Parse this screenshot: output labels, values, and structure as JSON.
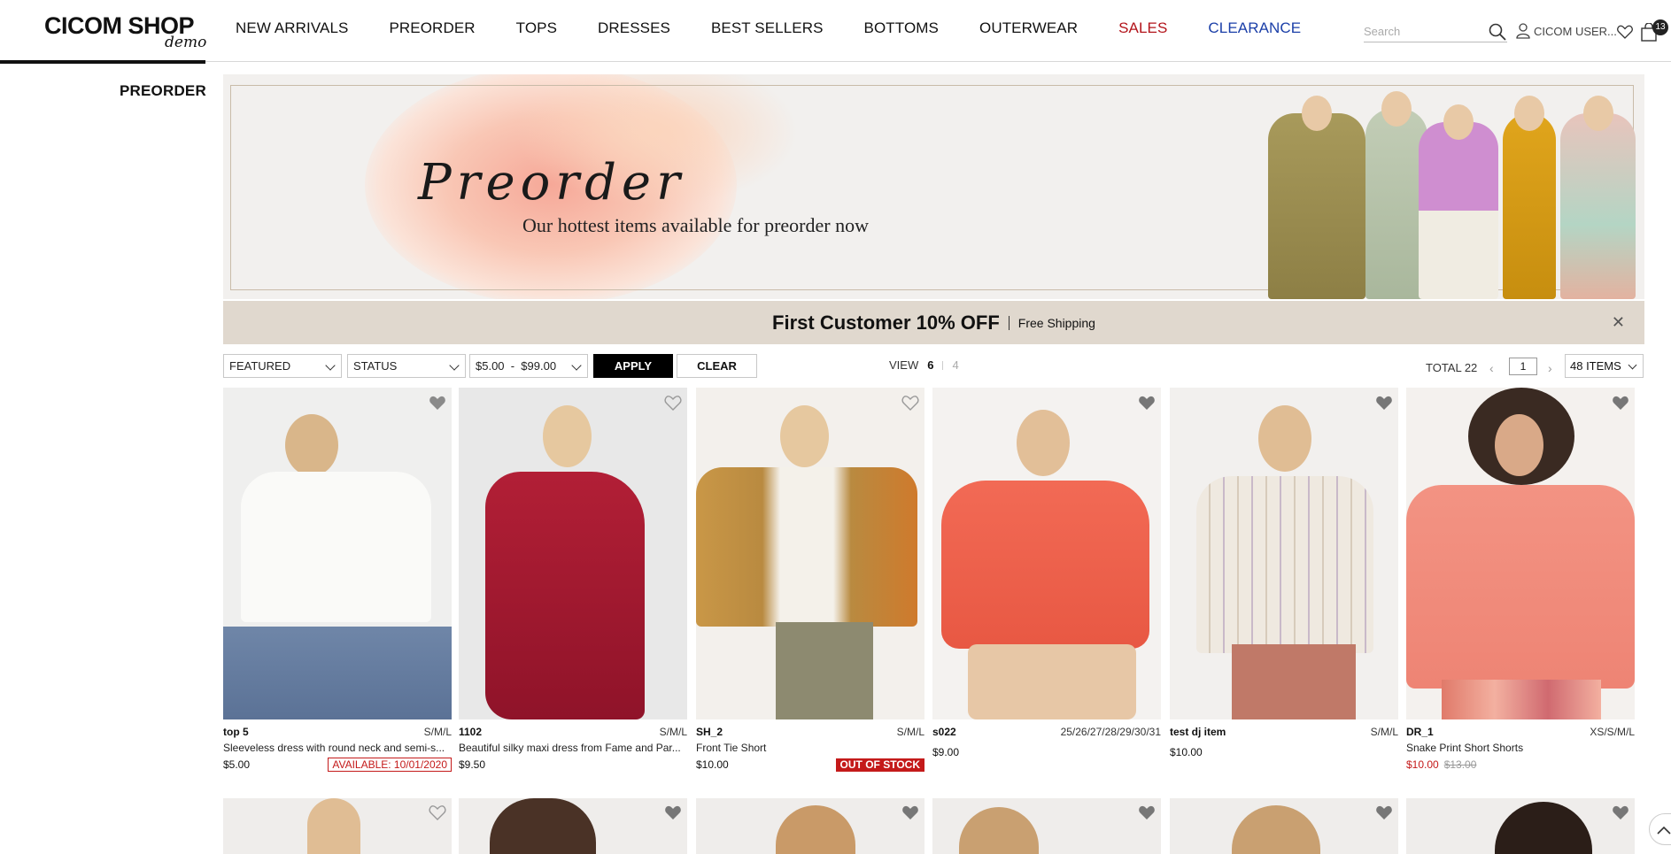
{
  "brand": {
    "main": "CICOM SHOP",
    "sub": "demo"
  },
  "nav": [
    {
      "label": "NEW ARRIVALS",
      "style": "normal"
    },
    {
      "label": "PREORDER",
      "style": "normal"
    },
    {
      "label": "TOPS",
      "style": "normal"
    },
    {
      "label": "DRESSES",
      "style": "normal"
    },
    {
      "label": "BEST SELLERS",
      "style": "normal"
    },
    {
      "label": "BOTTOMS",
      "style": "normal"
    },
    {
      "label": "OUTERWEAR",
      "style": "normal"
    },
    {
      "label": "SALES",
      "style": "sales"
    },
    {
      "label": "CLEARANCE",
      "style": "clearance"
    }
  ],
  "header": {
    "search_placeholder": "Search",
    "user_label": "CICOM USER...",
    "cart_count": "13"
  },
  "sidebar": {
    "title": "PREORDER"
  },
  "banner": {
    "title": "Preorder",
    "subtitle": "Our hottest items available for preorder now"
  },
  "promo": {
    "title": "First Customer 10% OFF",
    "subtitle": "Free Shipping",
    "close": "✕"
  },
  "filters": {
    "sort": "FEATURED",
    "status": "STATUS",
    "price": "$5.00  -  $99.00",
    "apply": "APPLY",
    "clear": "CLEAR"
  },
  "view": {
    "label": "VIEW",
    "active": "6",
    "inactive": "4"
  },
  "pagination": {
    "total": "TOTAL 22",
    "page": "1",
    "per_page": "48 ITEMS"
  },
  "colors": {
    "sale_red": "#b3141b",
    "clearance_blue": "#1b3fa8",
    "promo_bg": "#e0d8ce"
  },
  "products": [
    {
      "sku": "top 5",
      "sizes": "S/M/L",
      "desc": "Sleeveless dress with round neck and semi-s...",
      "price": "$5.00",
      "badge": "AVAILABLE: 10/01/2020",
      "badge_type": "avail"
    },
    {
      "sku": "1102",
      "sizes": "S/M/L",
      "desc": "Beautiful silky maxi dress from Fame and Par...",
      "price": "$9.50",
      "badge": "",
      "badge_type": ""
    },
    {
      "sku": "SH_2",
      "sizes": "S/M/L",
      "desc": "Front Tie Short",
      "price": "$10.00",
      "badge": "OUT OF STOCK",
      "badge_type": "oos"
    },
    {
      "sku": "s022",
      "sizes": "25/26/27/28/29/30/31",
      "desc": "",
      "price": "$9.00",
      "badge": "",
      "badge_type": ""
    },
    {
      "sku": "test dj item",
      "sizes": "S/M/L",
      "desc": "",
      "price": "$10.00",
      "badge": "",
      "badge_type": ""
    },
    {
      "sku": "DR_1",
      "sizes": "XS/S/M/L",
      "desc": "Snake Print Short Shorts",
      "price": "$10.00",
      "old_price": "$13.00",
      "badge": "",
      "badge_type": "sale"
    }
  ]
}
